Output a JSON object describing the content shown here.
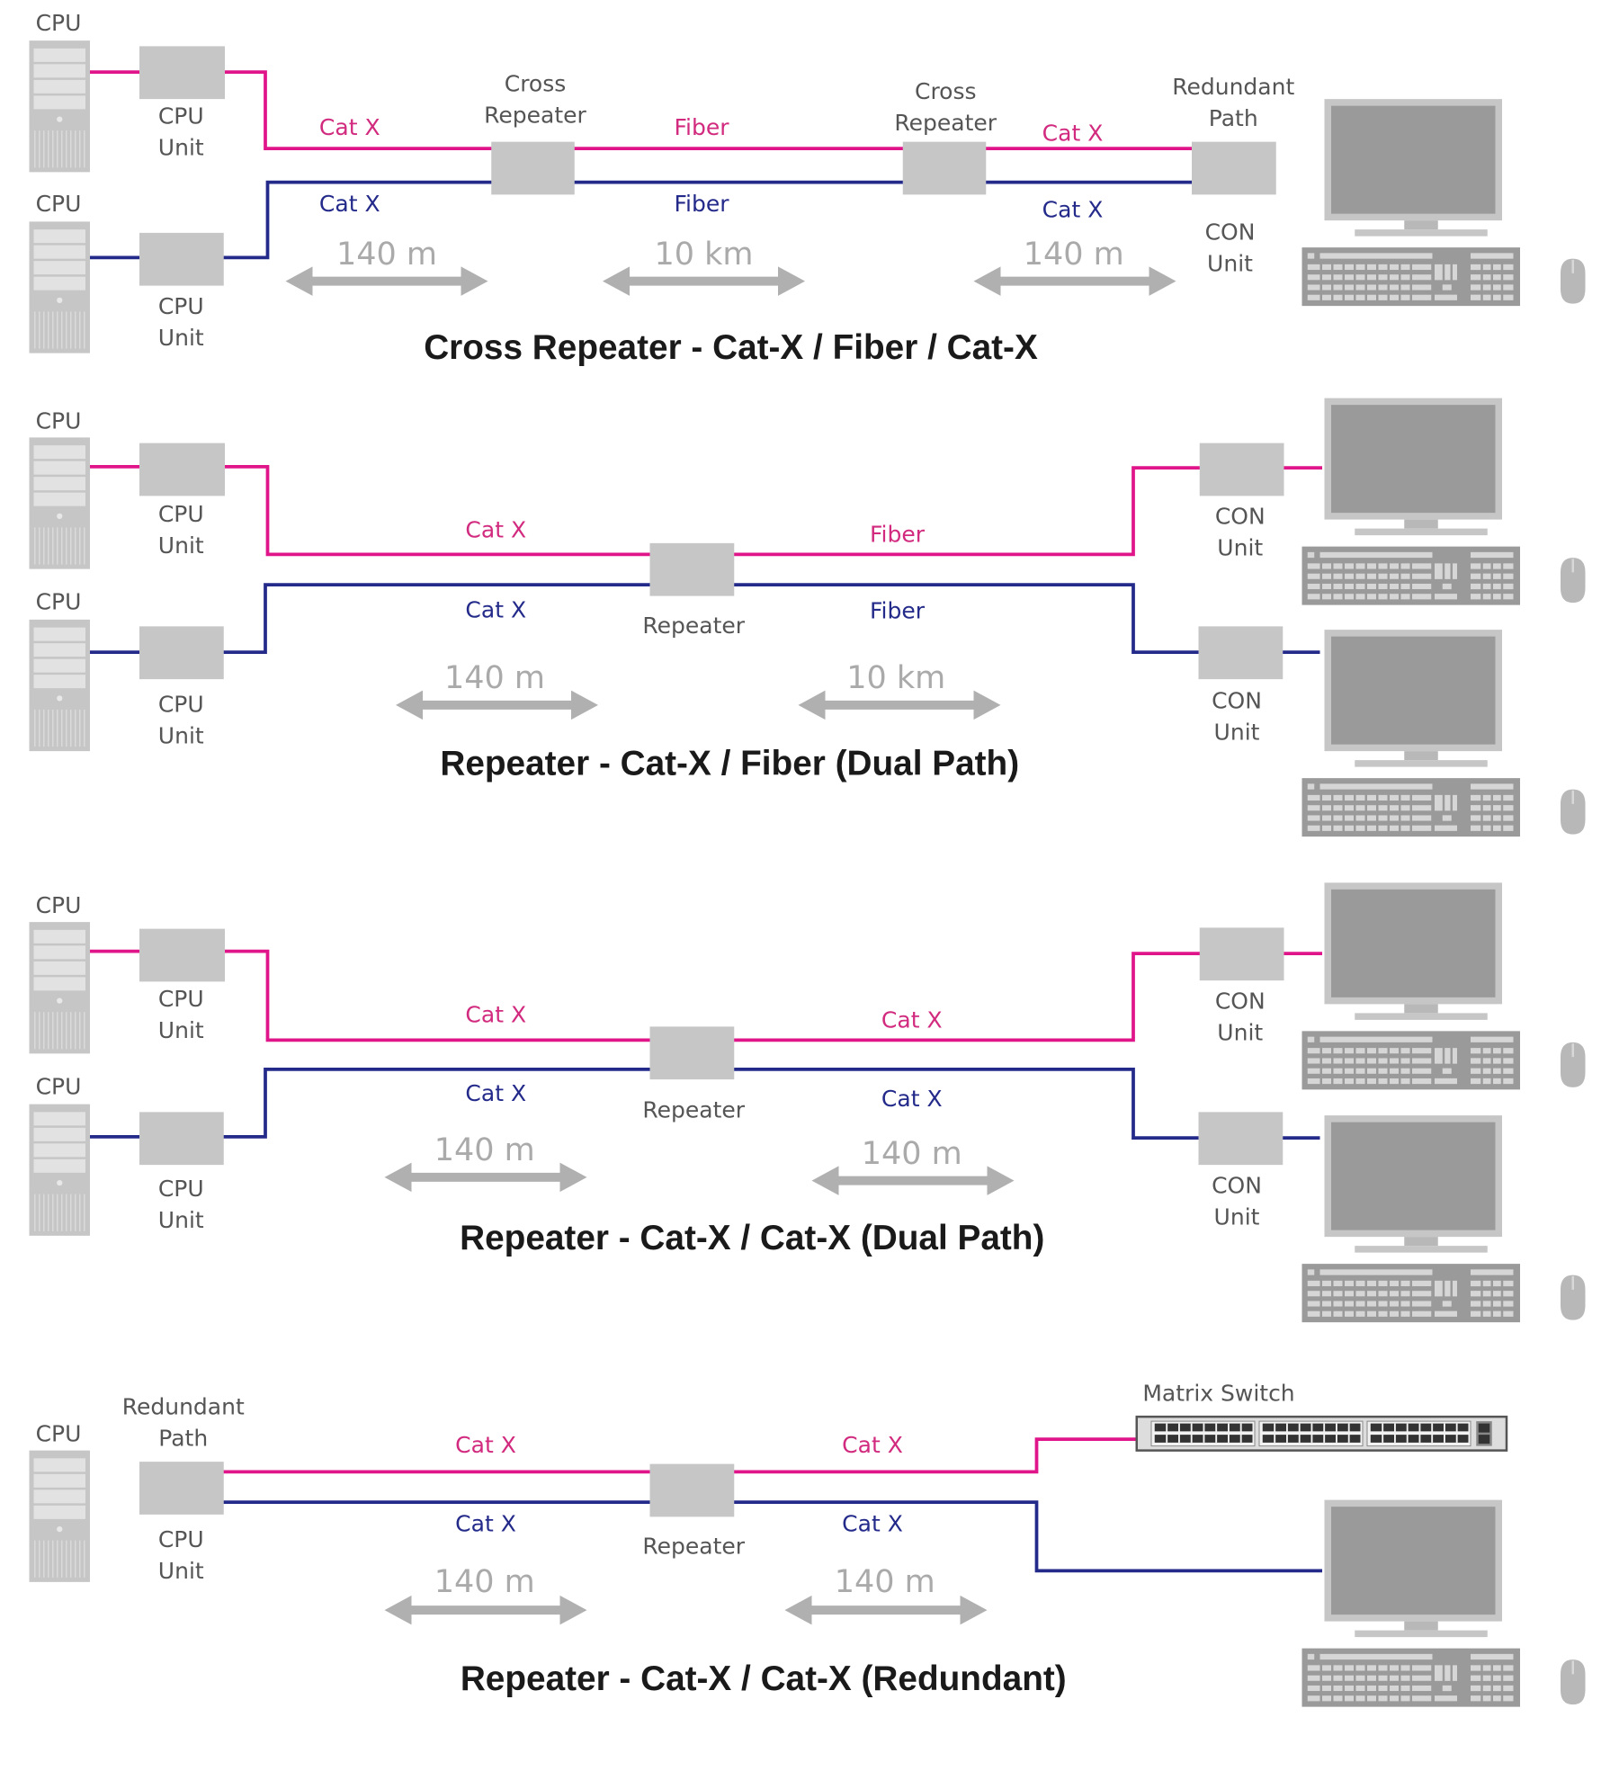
{
  "colors": {
    "primary_path": "#e0158a",
    "secondary_path": "#232a8a",
    "device": "#c6c6c6",
    "distance": "#aaaaaa"
  },
  "diagrams": [
    {
      "title": "Cross Repeater - Cat-X / Fiber / Cat-X",
      "cpu_label": "CPU",
      "cpu_unit": [
        "CPU",
        "Unit"
      ],
      "repeater1": [
        "Cross",
        "Repeater"
      ],
      "repeater2": [
        "Cross",
        "Repeater"
      ],
      "redundant": [
        "Redundant",
        "Path"
      ],
      "con_unit": [
        "CON",
        "Unit"
      ],
      "cables_top": [
        "Cat X",
        "Fiber",
        "Cat X"
      ],
      "cables_bottom": [
        "Cat X",
        "Fiber",
        "Cat X"
      ],
      "distances": [
        "140 m",
        "10 km",
        "140 m"
      ]
    },
    {
      "title": "Repeater - Cat-X / Fiber (Dual Path)",
      "cpu_label": "CPU",
      "cpu_unit": [
        "CPU",
        "Unit"
      ],
      "repeater": "Repeater",
      "con_unit": [
        "CON",
        "Unit"
      ],
      "cables_top": [
        "Cat X",
        "Fiber"
      ],
      "cables_bottom": [
        "Cat X",
        "Fiber"
      ],
      "distances": [
        "140 m",
        "10 km"
      ]
    },
    {
      "title": "Repeater - Cat-X / Cat-X (Dual Path)",
      "cpu_label": "CPU",
      "cpu_unit": [
        "CPU",
        "Unit"
      ],
      "repeater": "Repeater",
      "con_unit": [
        "CON",
        "Unit"
      ],
      "cables_top": [
        "Cat X",
        "Cat X"
      ],
      "cables_bottom": [
        "Cat X",
        "Cat X"
      ],
      "distances": [
        "140 m",
        "140 m"
      ]
    },
    {
      "title": "Repeater - Cat-X / Cat-X (Redundant)",
      "cpu_label": "CPU",
      "redundant": [
        "Redundant",
        "Path"
      ],
      "cpu_unit": [
        "CPU",
        "Unit"
      ],
      "repeater": "Repeater",
      "matrix_switch": "Matrix Switch",
      "cables_top": [
        "Cat X",
        "Cat X"
      ],
      "cables_bottom": [
        "Cat X",
        "Cat X"
      ],
      "distances": [
        "140 m",
        "140 m"
      ]
    }
  ]
}
